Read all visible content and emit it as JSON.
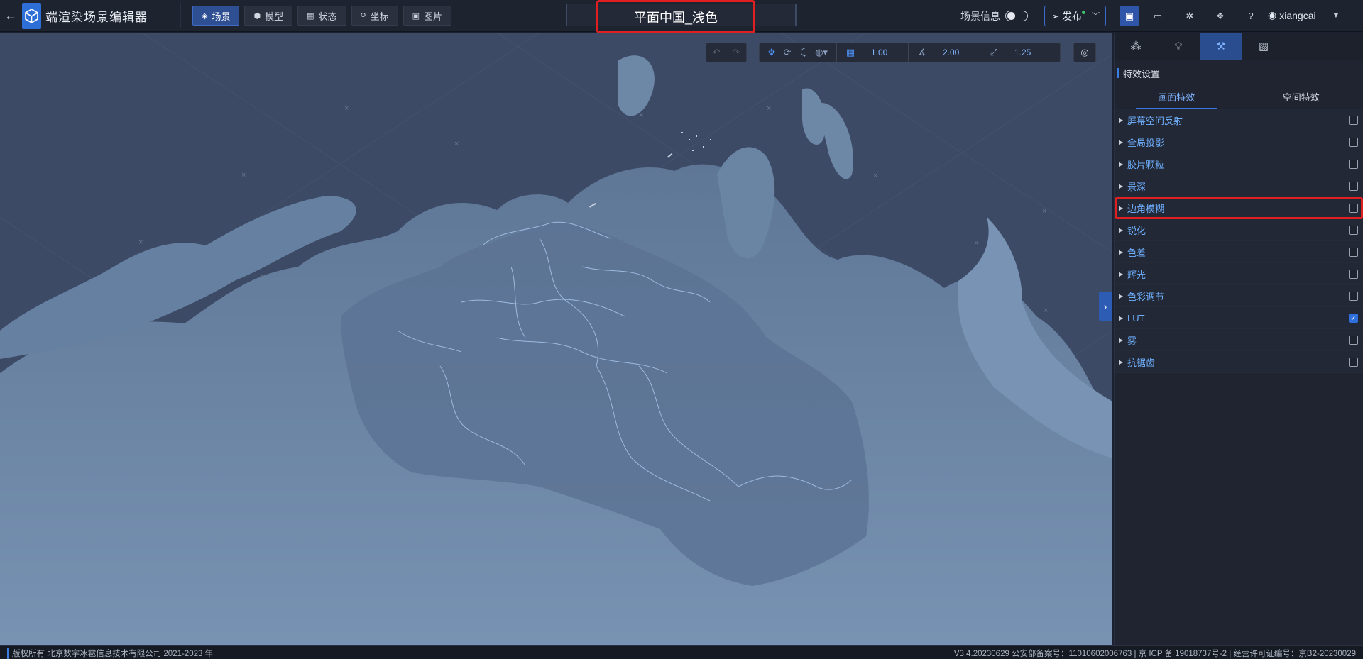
{
  "app": {
    "title": "端渲染场景编辑器"
  },
  "nav": {
    "tabs": [
      {
        "label": "场景",
        "icon": "layers-icon",
        "active": true
      },
      {
        "label": "模型",
        "icon": "cube-icon"
      },
      {
        "label": "状态",
        "icon": "grid-icon"
      },
      {
        "label": "坐标",
        "icon": "coordinate-icon"
      },
      {
        "label": "图片",
        "icon": "image-icon"
      }
    ]
  },
  "scene": {
    "name": "平面中国_浅色"
  },
  "header": {
    "scene_info_label": "场景信息",
    "scene_info_enabled": false,
    "publish_label": "发布",
    "user_name": "xiangcai"
  },
  "viewport_toolbar": {
    "grid_value": "1.00",
    "angle_value": "2.00",
    "scale_value": "1.25"
  },
  "panel": {
    "tabs": [
      "environment-icon",
      "light-icon",
      "effects-icon",
      "chart-icon"
    ],
    "section_title": "特效设置",
    "subtabs": [
      "画面特效",
      "空间特效"
    ],
    "effects": [
      {
        "label": "屏幕空间反射",
        "checked": false
      },
      {
        "label": "全局投影",
        "checked": false
      },
      {
        "label": "胶片颗粒",
        "checked": false
      },
      {
        "label": "景深",
        "checked": false
      },
      {
        "label": "边角模糊",
        "checked": false
      },
      {
        "label": "锐化",
        "checked": false
      },
      {
        "label": "色差",
        "checked": false
      },
      {
        "label": "辉光",
        "checked": false
      },
      {
        "label": "色彩调节",
        "checked": false
      },
      {
        "label": "LUT",
        "checked": true
      },
      {
        "label": "雾",
        "checked": false
      },
      {
        "label": "抗锯齿",
        "checked": false
      }
    ]
  },
  "footer": {
    "copyright": "版权所有 北京数字冰雹信息技术有限公司 2021-2023 年",
    "version_info": "V3.4.20230629 公安部备案号：11010602006763 | 京 ICP 备 19018737号-2 | 经营许可证编号：京B2-20230029"
  },
  "colors": {
    "accent": "#2e55a8",
    "highlight": "#e02020",
    "map_land": "#6b87a8",
    "map_sea": "#3d4b66"
  }
}
